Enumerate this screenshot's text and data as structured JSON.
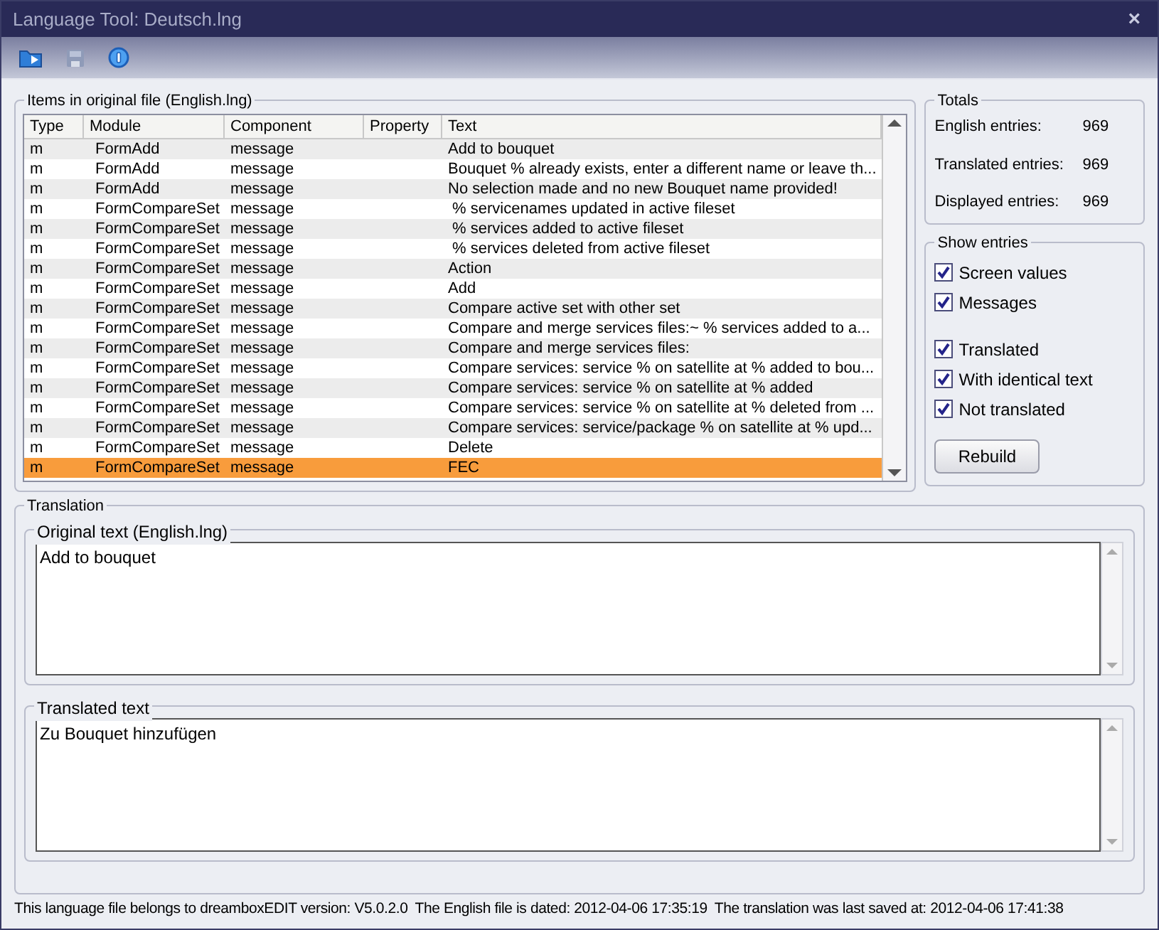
{
  "window": {
    "title": "Language Tool: Deutsch.lng",
    "close": "×"
  },
  "items": {
    "title": "Items in original file (English.lng)",
    "columns": [
      "Type",
      "Module",
      "Component",
      "Property",
      "Text"
    ],
    "rows": [
      {
        "cells": [
          "m",
          "FormAdd",
          "message",
          "",
          "Add to bouquet"
        ],
        "selected": false
      },
      {
        "cells": [
          "m",
          "FormAdd",
          "message",
          "",
          "Bouquet % already exists, enter a different name or leave th..."
        ],
        "selected": false
      },
      {
        "cells": [
          "m",
          "FormAdd",
          "message",
          "",
          "No selection made and no new Bouquet name provided!"
        ],
        "selected": false
      },
      {
        "cells": [
          "m",
          "FormCompareSet",
          "message",
          "",
          " % servicenames updated in active fileset"
        ],
        "selected": false
      },
      {
        "cells": [
          "m",
          "FormCompareSet",
          "message",
          "",
          " % services added to active fileset"
        ],
        "selected": false
      },
      {
        "cells": [
          "m",
          "FormCompareSet",
          "message",
          "",
          " % services deleted from active fileset"
        ],
        "selected": false
      },
      {
        "cells": [
          "m",
          "FormCompareSet",
          "message",
          "",
          "Action"
        ],
        "selected": false
      },
      {
        "cells": [
          "m",
          "FormCompareSet",
          "message",
          "",
          "Add"
        ],
        "selected": false
      },
      {
        "cells": [
          "m",
          "FormCompareSet",
          "message",
          "",
          "Compare active set with other set"
        ],
        "selected": false
      },
      {
        "cells": [
          "m",
          "FormCompareSet",
          "message",
          "",
          "Compare and merge services files:~ % services added to a..."
        ],
        "selected": false
      },
      {
        "cells": [
          "m",
          "FormCompareSet",
          "message",
          "",
          "Compare and merge services files:"
        ],
        "selected": false
      },
      {
        "cells": [
          "m",
          "FormCompareSet",
          "message",
          "",
          "Compare services: service % on satellite at % added to bou..."
        ],
        "selected": false
      },
      {
        "cells": [
          "m",
          "FormCompareSet",
          "message",
          "",
          "Compare services: service % on satellite at % added"
        ],
        "selected": false
      },
      {
        "cells": [
          "m",
          "FormCompareSet",
          "message",
          "",
          "Compare services: service % on satellite at % deleted from ..."
        ],
        "selected": false
      },
      {
        "cells": [
          "m",
          "FormCompareSet",
          "message",
          "",
          "Compare services: service/package % on satellite at % upd..."
        ],
        "selected": false
      },
      {
        "cells": [
          "m",
          "FormCompareSet",
          "message",
          "",
          "Delete"
        ],
        "selected": false
      },
      {
        "cells": [
          "m",
          "FormCompareSet",
          "message",
          "",
          "FEC"
        ],
        "selected": true
      }
    ]
  },
  "totals": {
    "title": "Totals",
    "entries": [
      {
        "label": "English entries:",
        "value": "969"
      },
      {
        "label": "Translated entries:",
        "value": "969"
      },
      {
        "label": "Displayed entries:",
        "value": "969"
      }
    ]
  },
  "show_entries": {
    "title": "Show entries",
    "groups": [
      [
        {
          "label": "Screen values",
          "checked": true
        },
        {
          "label": "Messages",
          "checked": true
        }
      ],
      [
        {
          "label": "Translated",
          "checked": true
        },
        {
          "label": "With identical text",
          "checked": true
        },
        {
          "label": "Not translated",
          "checked": true
        }
      ]
    ],
    "button": "Rebuild"
  },
  "translation": {
    "title": "Translation",
    "original": {
      "title": "Original text (English.lng)",
      "value": "Add to bouquet"
    },
    "translated": {
      "title": "Translated text",
      "value": "Zu Bouquet hinzufügen"
    }
  },
  "status_bar": [
    "This language file belongs to dreamboxEDIT version: V5.0.2.0",
    "The English file is dated: 2012-04-06 17:35:19",
    "The translation was last saved at: 2012-04-06 17:41:38"
  ]
}
